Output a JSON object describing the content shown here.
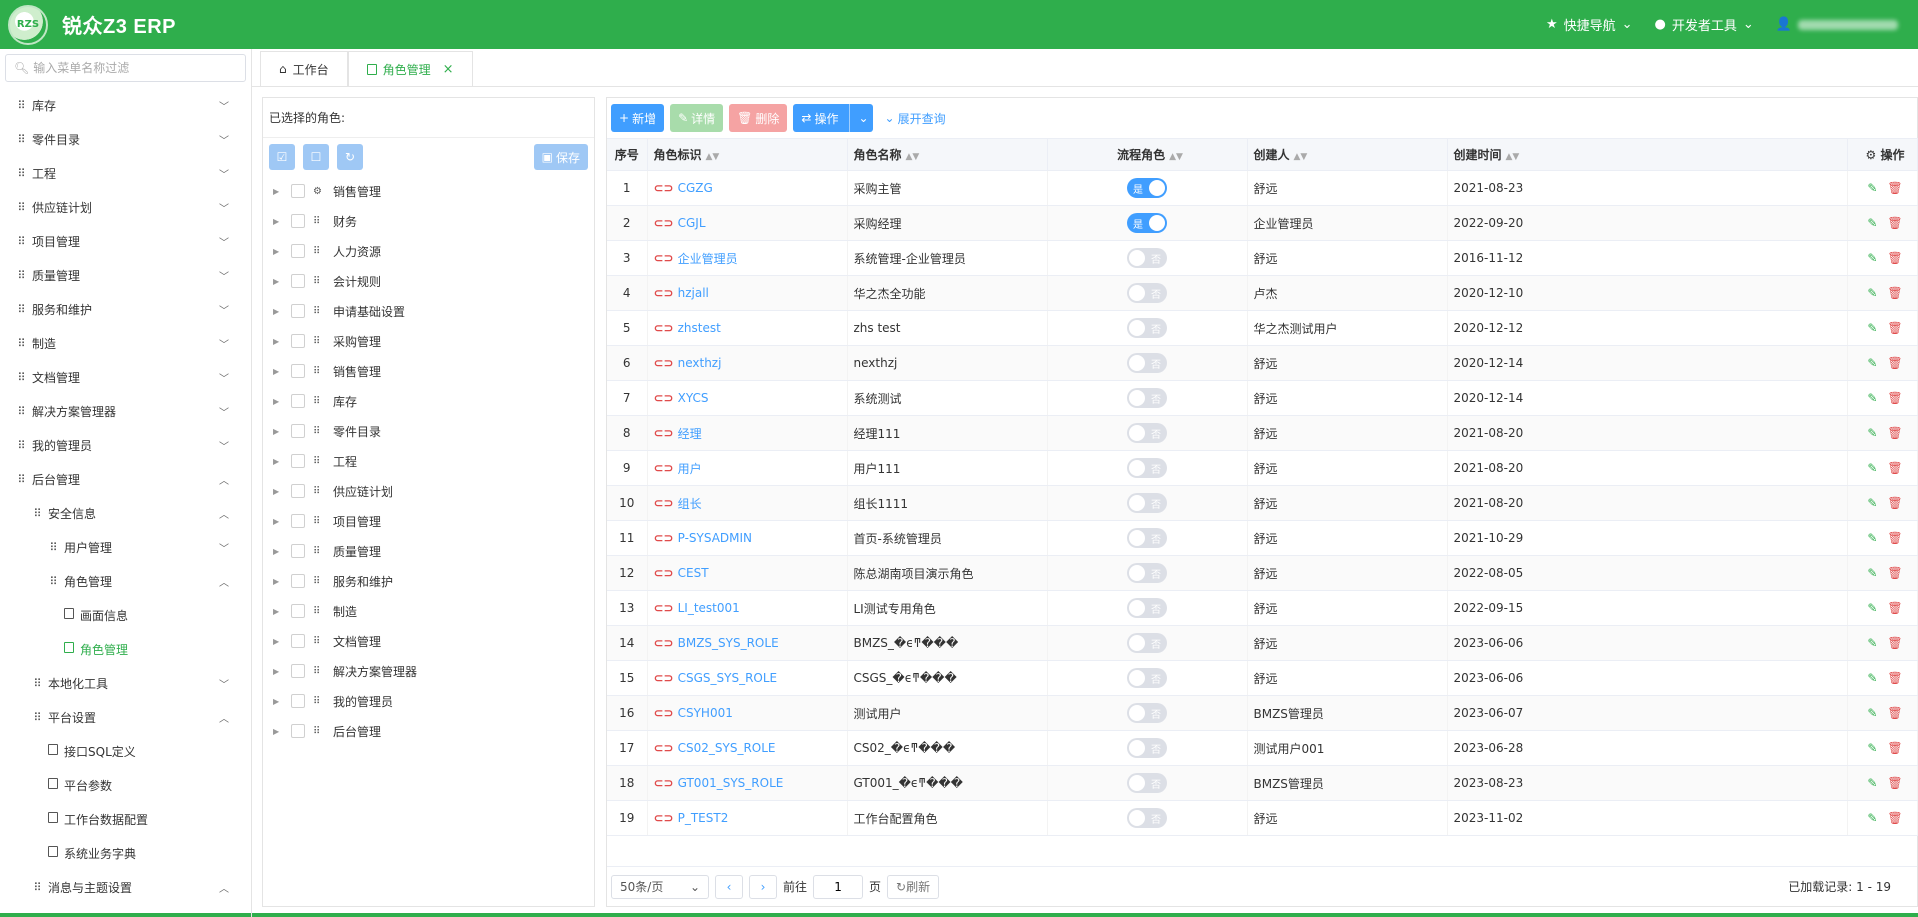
{
  "app": {
    "logo_text": "RZS",
    "title": "锐众Z3 ERP",
    "brand_color": "#2fae4c",
    "accent_color": "#409eff"
  },
  "topnav": {
    "quick_nav": "快捷导航",
    "dev_tools": "开发者工具"
  },
  "sidebar": {
    "search_placeholder": "输入菜单名称过滤",
    "items": [
      {
        "label": "库存",
        "level": 0,
        "icon": "grid-icon",
        "chev": "down"
      },
      {
        "label": "零件目录",
        "level": 0,
        "icon": "grid-icon",
        "chev": "down"
      },
      {
        "label": "工程",
        "level": 0,
        "icon": "grid-icon",
        "chev": "down"
      },
      {
        "label": "供应链计划",
        "level": 0,
        "icon": "grid-icon",
        "chev": "down"
      },
      {
        "label": "项目管理",
        "level": 0,
        "icon": "grid-icon",
        "chev": "down"
      },
      {
        "label": "质量管理",
        "level": 0,
        "icon": "grid-icon",
        "chev": "down"
      },
      {
        "label": "服务和维护",
        "level": 0,
        "icon": "grid-icon",
        "chev": "down"
      },
      {
        "label": "制造",
        "level": 0,
        "icon": "grid-icon",
        "chev": "down"
      },
      {
        "label": "文档管理",
        "level": 0,
        "icon": "grid-icon",
        "chev": "down"
      },
      {
        "label": "解决方案管理器",
        "level": 0,
        "icon": "grid-icon",
        "chev": "down"
      },
      {
        "label": "我的管理员",
        "level": 0,
        "icon": "grid-icon",
        "chev": "down"
      },
      {
        "label": "后台管理",
        "level": 0,
        "icon": "grid-icon",
        "chev": "up"
      },
      {
        "label": "安全信息",
        "level": 1,
        "icon": "grid-icon",
        "chev": "up"
      },
      {
        "label": "用户管理",
        "level": 2,
        "icon": "grid-icon",
        "chev": "down"
      },
      {
        "label": "角色管理",
        "level": 2,
        "icon": "grid-icon",
        "chev": "up"
      },
      {
        "label": "画面信息",
        "level": 3,
        "icon": "doc-icon",
        "chev": ""
      },
      {
        "label": "角色管理",
        "level": 3,
        "icon": "doc-icon",
        "chev": "",
        "active": true
      },
      {
        "label": "本地化工具",
        "level": 1,
        "icon": "grid-icon",
        "chev": "down"
      },
      {
        "label": "平台设置",
        "level": 1,
        "icon": "grid-icon",
        "chev": "up"
      },
      {
        "label": "接口SQL定义",
        "level": 2,
        "icon": "doc-icon",
        "chev": ""
      },
      {
        "label": "平台参数",
        "level": 2,
        "icon": "doc-icon",
        "chev": ""
      },
      {
        "label": "工作台数据配置",
        "level": 2,
        "icon": "doc-icon",
        "chev": ""
      },
      {
        "label": "系统业务字典",
        "level": 2,
        "icon": "doc-icon",
        "chev": ""
      },
      {
        "label": "消息与主题设置",
        "level": 1,
        "icon": "grid-icon",
        "chev": "up"
      }
    ]
  },
  "tabs": [
    {
      "label": "工作台",
      "icon": "home-icon",
      "active": false
    },
    {
      "label": "角色管理",
      "icon": "doc-icon",
      "active": true
    }
  ],
  "left_panel": {
    "title": "已选择的角色:",
    "save_label": "保存",
    "tree": [
      "销售管理",
      "财务",
      "人力资源",
      "会计规则",
      "申请基础设置",
      "采购管理",
      "销售管理",
      "库存",
      "零件目录",
      "工程",
      "供应链计划",
      "项目管理",
      "质量管理",
      "服务和维护",
      "制造",
      "文档管理",
      "解决方案管理器",
      "我的管理员",
      "后台管理"
    ]
  },
  "toolbar": {
    "add": "新增",
    "detail": "详情",
    "delete": "删除",
    "ops": "操作",
    "expand_query": "展开查询"
  },
  "table": {
    "headers": {
      "seq": "序号",
      "code": "角色标识",
      "name": "角色名称",
      "flow": "流程角色",
      "creator": "创建人",
      "created": "创建时间",
      "ops": "操作"
    },
    "switch_on": "是",
    "switch_off": "否",
    "rows": [
      {
        "seq": "1",
        "code": "CGZG",
        "name": "采购主管",
        "flow": true,
        "creator": "舒远",
        "created": "2021-08-23"
      },
      {
        "seq": "2",
        "code": "CGJL",
        "name": "采购经理",
        "flow": true,
        "creator": "企业管理员",
        "created": "2022-09-20"
      },
      {
        "seq": "3",
        "code": "企业管理员",
        "name": "系统管理-企业管理员",
        "flow": false,
        "creator": "舒远",
        "created": "2016-11-12"
      },
      {
        "seq": "4",
        "code": "hzjall",
        "name": "华之杰全功能",
        "flow": false,
        "creator": "卢杰",
        "created": "2020-12-10"
      },
      {
        "seq": "5",
        "code": "zhstest",
        "name": "zhs test",
        "flow": false,
        "creator": "华之杰测试用户",
        "created": "2020-12-12"
      },
      {
        "seq": "6",
        "code": "nexthzj",
        "name": "nexthzj",
        "flow": false,
        "creator": "舒远",
        "created": "2020-12-14"
      },
      {
        "seq": "7",
        "code": "XYCS",
        "name": "系统测试",
        "flow": false,
        "creator": "舒远",
        "created": "2020-12-14"
      },
      {
        "seq": "8",
        "code": "经理",
        "name": "经理111",
        "flow": false,
        "creator": "舒远",
        "created": "2021-08-20"
      },
      {
        "seq": "9",
        "code": "用户",
        "name": "用户111",
        "flow": false,
        "creator": "舒远",
        "created": "2021-08-20"
      },
      {
        "seq": "10",
        "code": "组长",
        "name": "组长1111",
        "flow": false,
        "creator": "舒远",
        "created": "2021-08-20"
      },
      {
        "seq": "11",
        "code": "P-SYSADMIN",
        "name": "首页-系统管理员",
        "flow": false,
        "creator": "舒远",
        "created": "2021-10-29"
      },
      {
        "seq": "12",
        "code": "CEST",
        "name": "陈总湖南项目演示角色",
        "flow": false,
        "creator": "舒远",
        "created": "2022-08-05"
      },
      {
        "seq": "13",
        "code": "LI_test001",
        "name": "LI测试专用角色",
        "flow": false,
        "creator": "舒远",
        "created": "2022-09-15"
      },
      {
        "seq": "14",
        "code": "BMZS_SYS_ROLE",
        "name": "BMZS_�ϵͳ���",
        "flow": false,
        "creator": "舒远",
        "created": "2023-06-06"
      },
      {
        "seq": "15",
        "code": "CSGS_SYS_ROLE",
        "name": "CSGS_�ϵͳ���",
        "flow": false,
        "creator": "舒远",
        "created": "2023-06-06"
      },
      {
        "seq": "16",
        "code": "CSYH001",
        "name": "测试用户",
        "flow": false,
        "creator": "BMZS管理员",
        "created": "2023-06-07"
      },
      {
        "seq": "17",
        "code": "CS02_SYS_ROLE",
        "name": "CS02_�ϵͳ���",
        "flow": false,
        "creator": "测试用户001",
        "created": "2023-06-28"
      },
      {
        "seq": "18",
        "code": "GT001_SYS_ROLE",
        "name": "GT001_�ϵͳ���",
        "flow": false,
        "creator": "BMZS管理员",
        "created": "2023-08-23"
      },
      {
        "seq": "19",
        "code": "P_TEST2",
        "name": "工作台配置角色",
        "flow": false,
        "creator": "舒远",
        "created": "2023-11-02"
      }
    ]
  },
  "pager": {
    "page_size": "50条/页",
    "goto": "前往",
    "page": "1",
    "page_unit": "页",
    "refresh": "刷新",
    "loaded": "已加载记录: 1 - 19"
  }
}
